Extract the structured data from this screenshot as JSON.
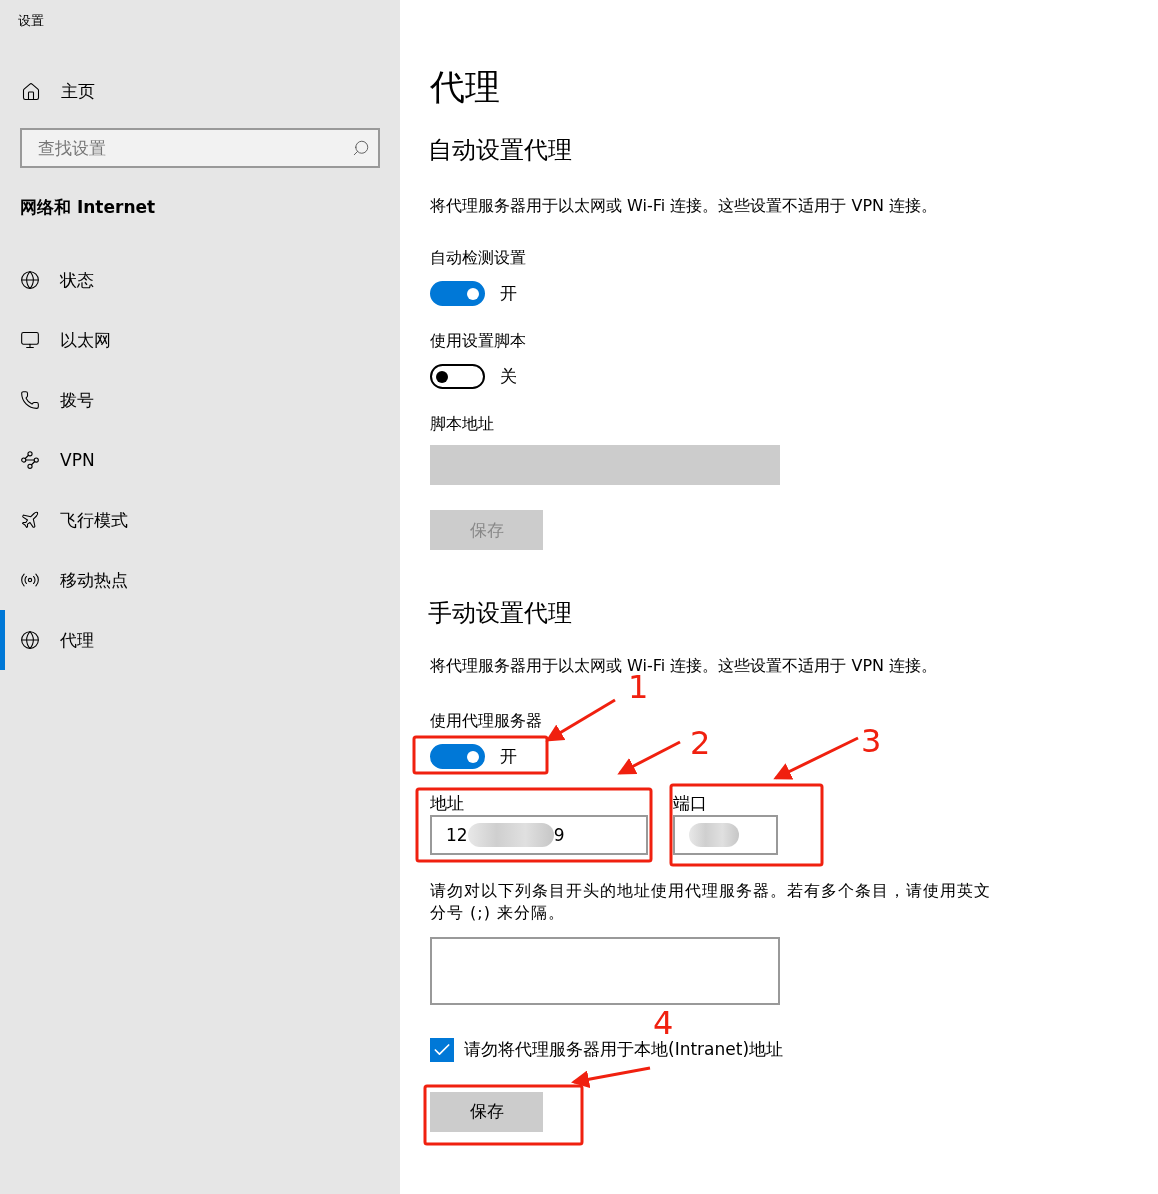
{
  "window": {
    "title": "设置"
  },
  "sidebar": {
    "home": "主页",
    "search": {
      "placeholder": "查找设置"
    },
    "section": "网络和 Internet",
    "items": [
      {
        "label": "状态",
        "selected": false
      },
      {
        "label": "以太网",
        "selected": false
      },
      {
        "label": "拨号",
        "selected": false
      },
      {
        "label": "VPN",
        "selected": false
      },
      {
        "label": "飞行模式",
        "selected": false
      },
      {
        "label": "移动热点",
        "selected": false
      },
      {
        "label": "代理",
        "selected": true
      }
    ]
  },
  "page": {
    "title": "代理",
    "auto": {
      "heading": "自动设置代理",
      "description": "将代理服务器用于以太网或 Wi-Fi 连接。这些设置不适用于 VPN 连接。",
      "detect": {
        "label": "自动检测设置",
        "on": true,
        "state_text": "开"
      },
      "script": {
        "label": "使用设置脚本",
        "on": false,
        "state_text": "关"
      },
      "script_address": {
        "label": "脚本地址",
        "disabled": true
      },
      "save": {
        "label": "保存",
        "disabled": true
      }
    },
    "manual": {
      "heading": "手动设置代理",
      "description": "将代理服务器用于以太网或 Wi-Fi 连接。这些设置不适用于 VPN 连接。",
      "use_proxy": {
        "label": "使用代理服务器",
        "on": true,
        "state_text": "开"
      },
      "address": {
        "label": "地址",
        "value_start": "12",
        "value_end": "9",
        "redacted": true
      },
      "port": {
        "label": "端口",
        "redacted": true
      },
      "exceptions": {
        "description": "请勿对以下列条目开头的地址使用代理服务器。若有多个条目，请使用英文分号 (;) 来分隔。"
      },
      "bypass_local": {
        "label": "请勿将代理服务器用于本地(Intranet)地址",
        "checked": true
      },
      "save": {
        "label": "保存",
        "disabled": false
      }
    }
  },
  "annotations": [
    {
      "number": "1"
    },
    {
      "number": "2"
    },
    {
      "number": "3"
    },
    {
      "number": "4"
    }
  ]
}
